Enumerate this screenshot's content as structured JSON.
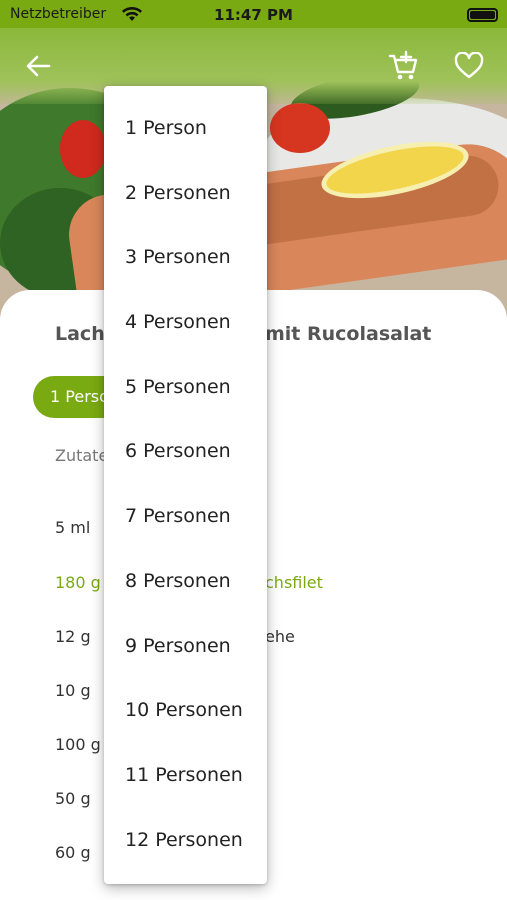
{
  "status_bar": {
    "carrier": "Netzbetreiber",
    "time": "11:47 PM"
  },
  "header": {
    "back_icon": "arrow-left-icon",
    "cart_icon": "cart-add-icon",
    "favorite_icon": "heart-outline-icon"
  },
  "recipe": {
    "title_left": "Lach",
    "title_right": "mit Rucolasalat",
    "servings_selected": "1 Person",
    "ingredients_label": "Zutate",
    "ingredients": [
      {
        "amount": "5 ml",
        "name": ""
      },
      {
        "amount": "180 g",
        "name": "chsfilet"
      },
      {
        "amount": "12 g",
        "name": "ehe"
      },
      {
        "amount": "10 g",
        "name": ""
      },
      {
        "amount": "100 g",
        "name": ""
      },
      {
        "amount": "50 g",
        "name": ""
      },
      {
        "amount": "60 g",
        "name": ""
      }
    ]
  },
  "servings_dropdown": {
    "options": [
      "1 Person",
      "2 Personen",
      "3 Personen",
      "4 Personen",
      "5 Personen",
      "6 Personen",
      "7 Personen",
      "8 Personen",
      "9 Personen",
      "10 Personen",
      "11 Personen",
      "12 Personen"
    ]
  },
  "colors": {
    "accent": "#7aaa12",
    "text": "#333333",
    "muted": "#777777"
  }
}
